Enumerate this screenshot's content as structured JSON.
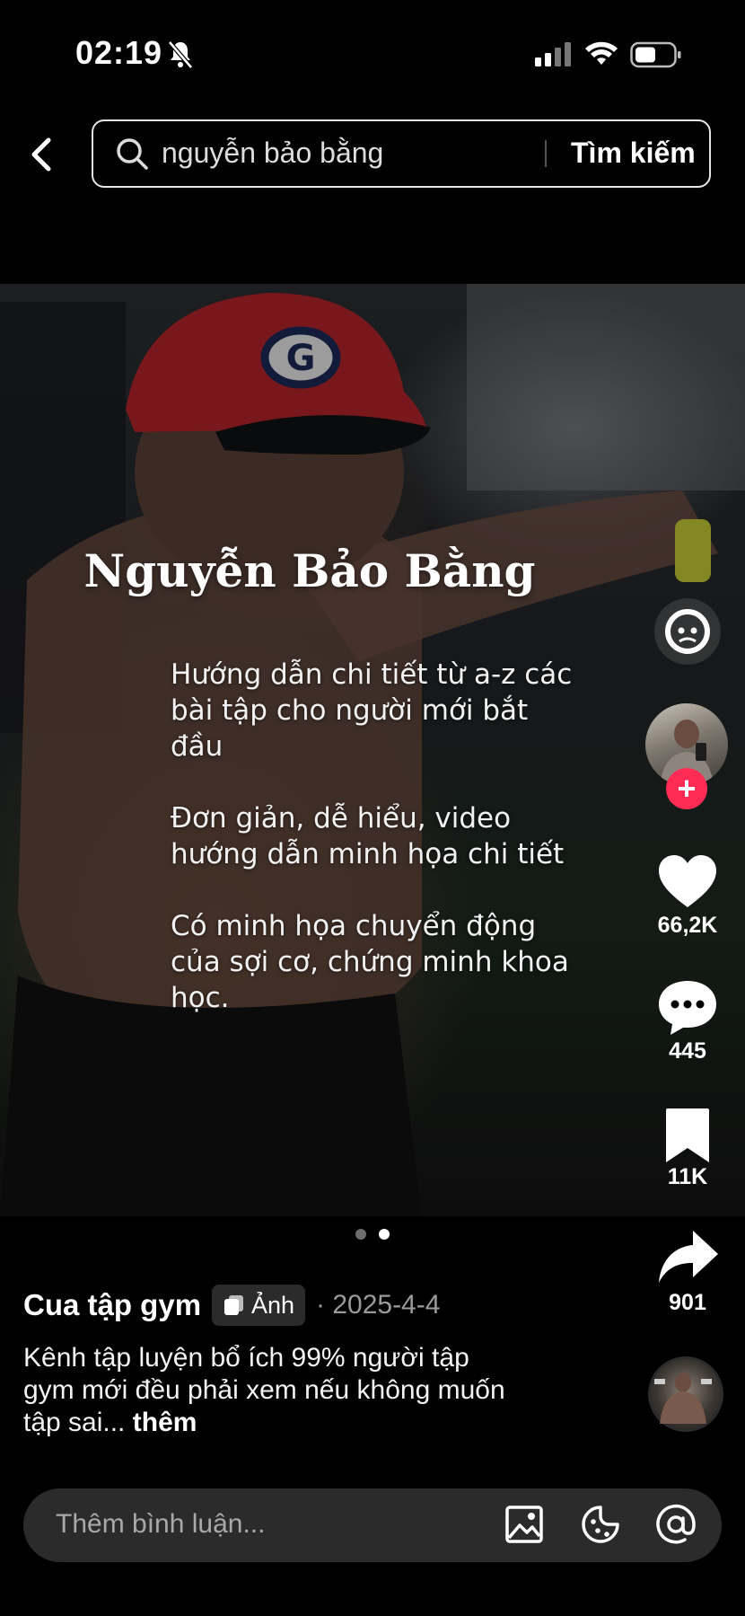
{
  "status_bar": {
    "time": "02:19",
    "icons": [
      "bell-slash-icon",
      "cellular-signal-icon",
      "wifi-icon",
      "battery-icon"
    ]
  },
  "search": {
    "query": "nguyễn bảo bằng",
    "button_label": "Tìm kiếm"
  },
  "post": {
    "overlay_title": "Nguyễn Bảo Bằng",
    "overlay_lines": [
      "Hướng dẫn chi tiết từ a-z các",
      "bài tập  cho người mới bắt",
      "đầu",
      "Đơn giản, dễ hiểu, video",
      "hướng dẫn minh họa chi tiết",
      "Có minh họa chuyển động",
      "của sợi cơ, chứng minh khoa",
      "học."
    ],
    "page_indicator": {
      "count": 2,
      "active": 2
    }
  },
  "actions": {
    "likes": "66,2K",
    "comments": "445",
    "saves": "11K",
    "shares": "901",
    "follow_symbol": "+"
  },
  "caption": {
    "author": "Cua tập gym",
    "type_tag": "Ảnh",
    "date": "· 2025-4-4",
    "description_lines": [
      "Kênh tập luyện bổ ích 99% người tập",
      "gym mới đều phải xem nếu không muốn",
      "tập sai..."
    ],
    "more_label": "thêm"
  },
  "comment_bar": {
    "placeholder": "Thêm bình luận..."
  },
  "colors": {
    "background": "#000000",
    "accent": "#fe2c55",
    "pill": "#2b2b2b"
  }
}
